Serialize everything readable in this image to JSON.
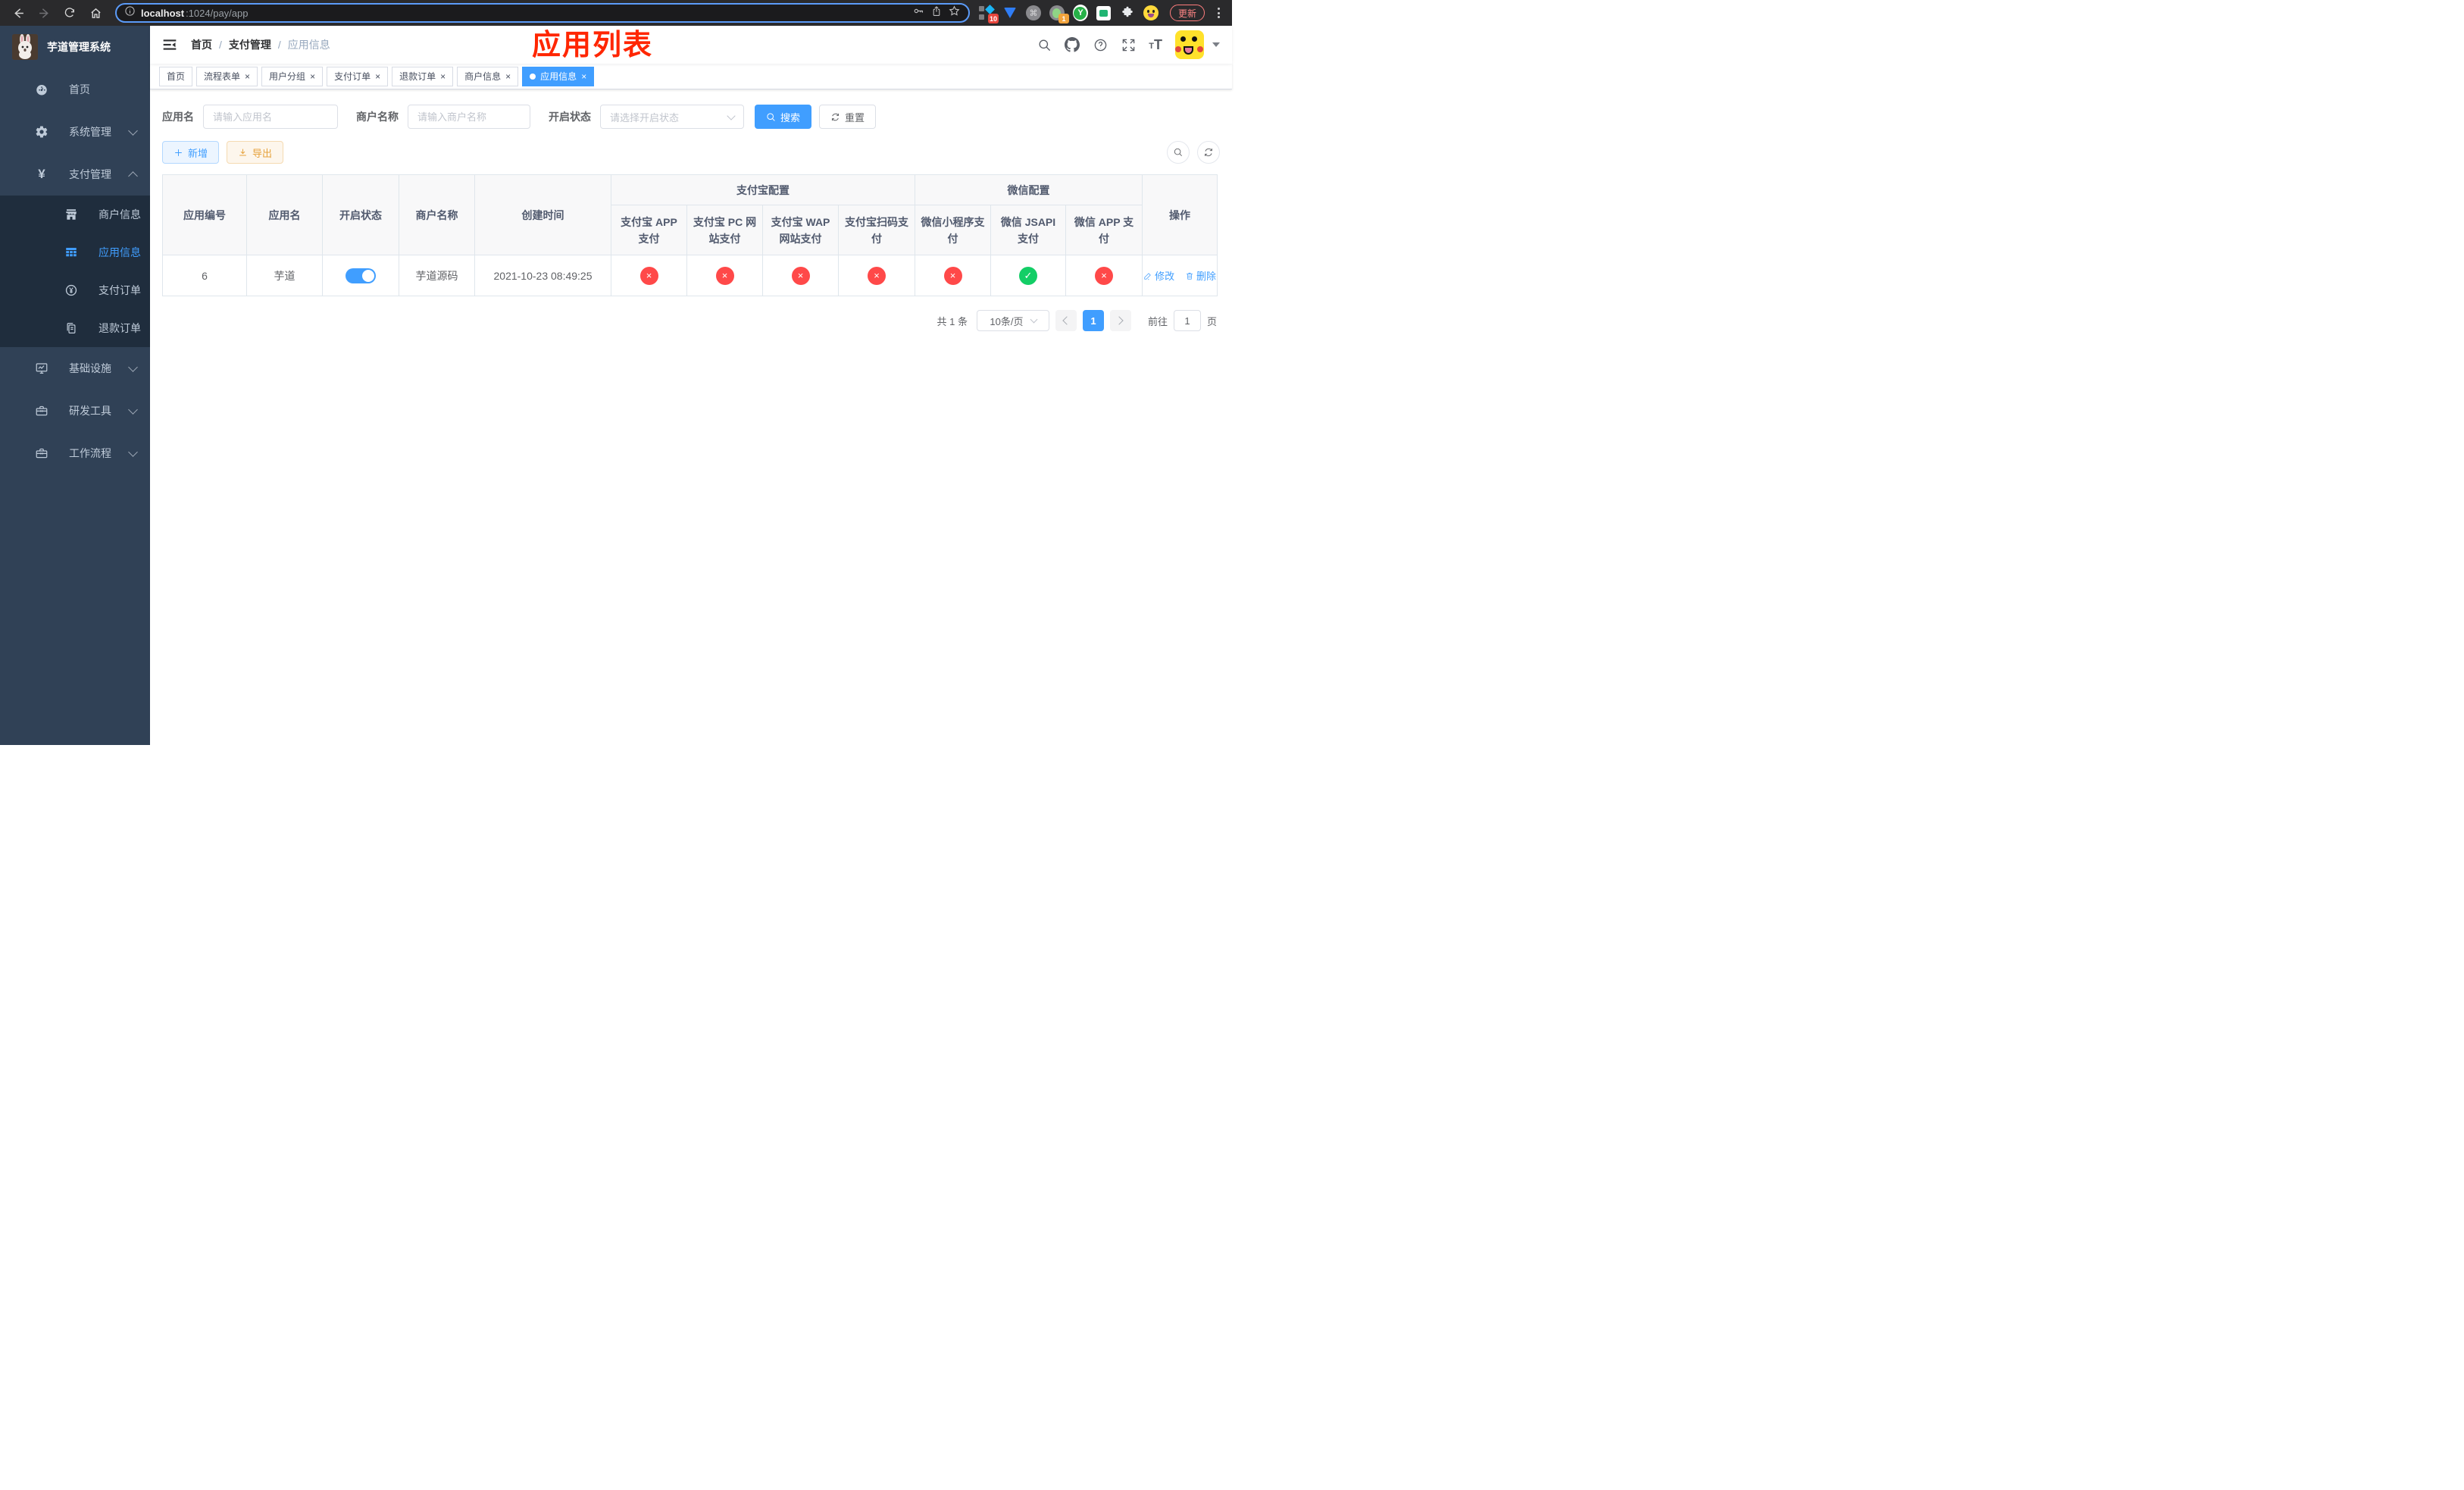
{
  "browser": {
    "url_host": "localhost",
    "url_path": ":1024/pay/app",
    "update_label": "更新",
    "extension_badges": {
      "first": "10",
      "second": "1"
    }
  },
  "sidebar": {
    "title": "芋道管理系统",
    "items": [
      {
        "label": "首页"
      },
      {
        "label": "系统管理"
      },
      {
        "label": "支付管理",
        "children": [
          {
            "label": "商户信息"
          },
          {
            "label": "应用信息"
          },
          {
            "label": "支付订单"
          },
          {
            "label": "退款订单"
          }
        ]
      },
      {
        "label": "基础设施"
      },
      {
        "label": "研发工具"
      },
      {
        "label": "工作流程"
      }
    ]
  },
  "navbar": {
    "breadcrumb": [
      "首页",
      "支付管理",
      "应用信息"
    ],
    "annotation": "应用列表"
  },
  "tabs": [
    {
      "label": "首页"
    },
    {
      "label": "流程表单"
    },
    {
      "label": "用户分组"
    },
    {
      "label": "支付订单"
    },
    {
      "label": "退款订单"
    },
    {
      "label": "商户信息"
    },
    {
      "label": "应用信息",
      "active": true
    }
  ],
  "filters": {
    "app_name_label": "应用名",
    "app_name_placeholder": "请输入应用名",
    "merchant_label": "商户名称",
    "merchant_placeholder": "请输入商户名称",
    "status_label": "开启状态",
    "status_placeholder": "请选择开启状态",
    "search_label": "搜索",
    "reset_label": "重置"
  },
  "toolbar": {
    "add_label": "新增",
    "export_label": "导出"
  },
  "table": {
    "columns": [
      "应用编号",
      "应用名",
      "开启状态",
      "商户名称",
      "创建时间"
    ],
    "groups": [
      {
        "label": "支付宝配置",
        "children": [
          "支付宝 APP 支付",
          "支付宝 PC 网站支付",
          "支付宝 WAP 网站支付",
          "支付宝扫码支付"
        ]
      },
      {
        "label": "微信配置",
        "children": [
          "微信小程序支付",
          "微信 JSAPI 支付",
          "微信 APP 支付"
        ]
      }
    ],
    "actions_label": "操作",
    "row": {
      "id": "6",
      "name": "芋道",
      "enabled": true,
      "merchant": "芋道源码",
      "created": "2021-10-23 08:49:25",
      "statuses": [
        "fail",
        "fail",
        "fail",
        "fail",
        "fail",
        "success",
        "fail"
      ],
      "edit_label": "修改",
      "delete_label": "删除"
    }
  },
  "pagination": {
    "total_label": "共 1 条",
    "page_size_label": "10条/页",
    "current_page": "1",
    "goto_label": "前往",
    "goto_value": "1",
    "page_unit_label": "页"
  },
  "colors": {
    "accent": "#409eff",
    "success": "#13ce66",
    "danger": "#ff4949",
    "sidebar_bg": "#304156",
    "submenu_bg": "#1f2d3d",
    "annotation_red": "#ff2600"
  }
}
